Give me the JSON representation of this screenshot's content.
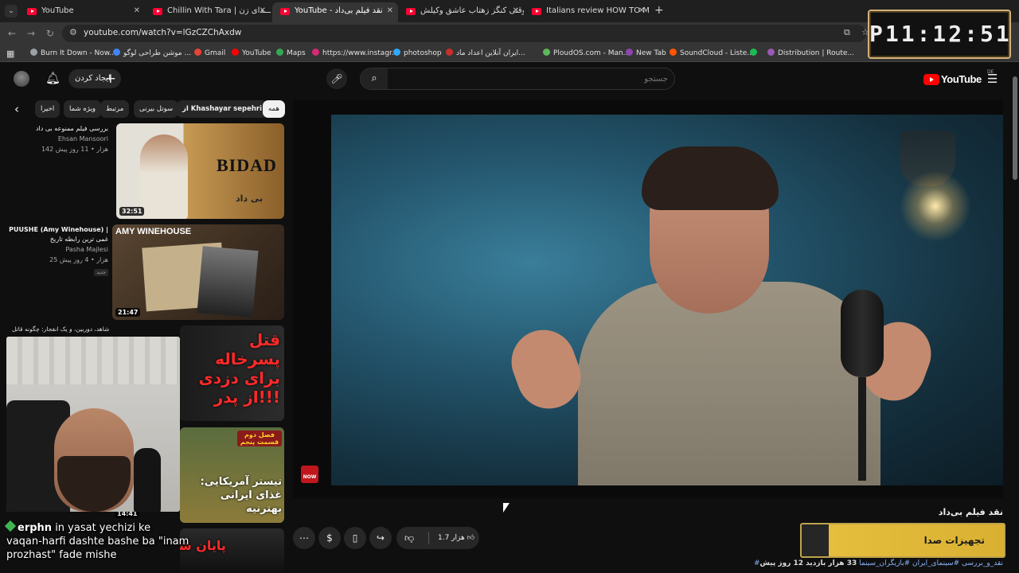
{
  "browser": {
    "tabs": [
      {
        "title": "YouTube"
      },
      {
        "title": "Chillin With Tara | صـــدای زن - \\"
      },
      {
        "title": "YouTube - نقد فیلم بی‌داد"
      },
      {
        "title": "وقتی کنگز زهتاب عاشق وکیلش ..."
      },
      {
        "title": "Italians review HOW TO MAKE"
      }
    ],
    "new_tab": "+",
    "url": "youtube.com/watch?v=lGzCZChAxdw",
    "bookmarks": [
      {
        "label": "Burn It Down - Now...",
        "color": "#9aa0a6"
      },
      {
        "label": "موشن طراحی لوگو ...",
        "color": "#4285f4"
      },
      {
        "label": "Gmail",
        "color": "#ea4335"
      },
      {
        "label": "YouTube",
        "color": "#ff0000"
      },
      {
        "label": "Maps",
        "color": "#34a853"
      },
      {
        "label": "https://www.instagr...",
        "color": "#d62976"
      },
      {
        "label": "photoshop",
        "color": "#31a8ff"
      },
      {
        "label": "ایران آنلاین اعداد ماد...",
        "color": "#c9302c"
      },
      {
        "label": "PloudOS.com - Man...",
        "color": "#5cb85c"
      },
      {
        "label": "New Tab",
        "color": "#8e44ad"
      },
      {
        "label": "SoundCloud - Liste...",
        "color": "#ff5500"
      },
      {
        "label": "Distribution | Route...",
        "color": "#9b59b6"
      }
    ],
    "clock": "P11:12:51"
  },
  "youtube": {
    "create_label": "ایجاد کردن",
    "search_placeholder": "جستجو",
    "logo_text": "YouTube",
    "logo_country": "DE",
    "chips": [
      "همه",
      "از Khashayar sepehri",
      "سوتل بیرنی",
      "مرتبط",
      "ویژه شما",
      "اخیرا"
    ],
    "recommendations": [
      {
        "title": "بررسی فیلم ممنوعه بی داد",
        "channel": "Ehsan Mansoori",
        "stats": "142 هزار  •  11 روز پیش",
        "duration": "32:51",
        "thumb_title": "BIDAD",
        "thumb_sub": "بی داد"
      },
      {
        "title": "PUUSHE (Amy Winehouse) |",
        "title2": "غمی ترین رابطه تاریخ",
        "channel": "Pasha Majlesi",
        "stats": "25 هزار  •  4 روز پیش",
        "badge": "جدید",
        "duration": "21:47",
        "thumb_title": "AMY WINEHOUSE"
      },
      {
        "title": "شاهد، دوربین، و یک انفجار: چگونه قاتل",
        "thumb_title": "قتل پسرخاله برای دزدی از پدر!!!"
      },
      {
        "duration": "14:41",
        "thumb_title": "تیستر آمریکایی: غذای ایرانی بهترنیه",
        "thumb_sub": "فصل دوم قسمت پنجم"
      },
      {
        "thumb_title": "پایان شب"
      }
    ],
    "video": {
      "title": "نقد فیلم بی‌داد",
      "likes": "1.7 هزار",
      "stats": "33 هزار بازدید  12 روز پیش",
      "tags": "#نقد_و_بررسی #سینمای_ایران #بازیگران_سینما",
      "now_badge": "NOW"
    },
    "promo": "تجهیزات صدا"
  },
  "stream": {
    "cam_caption": "شاهد، دوربین، و یک انفجار: چگونه قاتل",
    "chat": {
      "user": "erphn",
      "message": "in yasat yechizi ke vaqan-harfi dashte bashe ba \"inam prozhast\" fade mishe"
    }
  },
  "colors": {
    "accent": "#ff0000",
    "background": "#0f0f0f",
    "chip": "#272727",
    "promo": "#e6be3e"
  }
}
